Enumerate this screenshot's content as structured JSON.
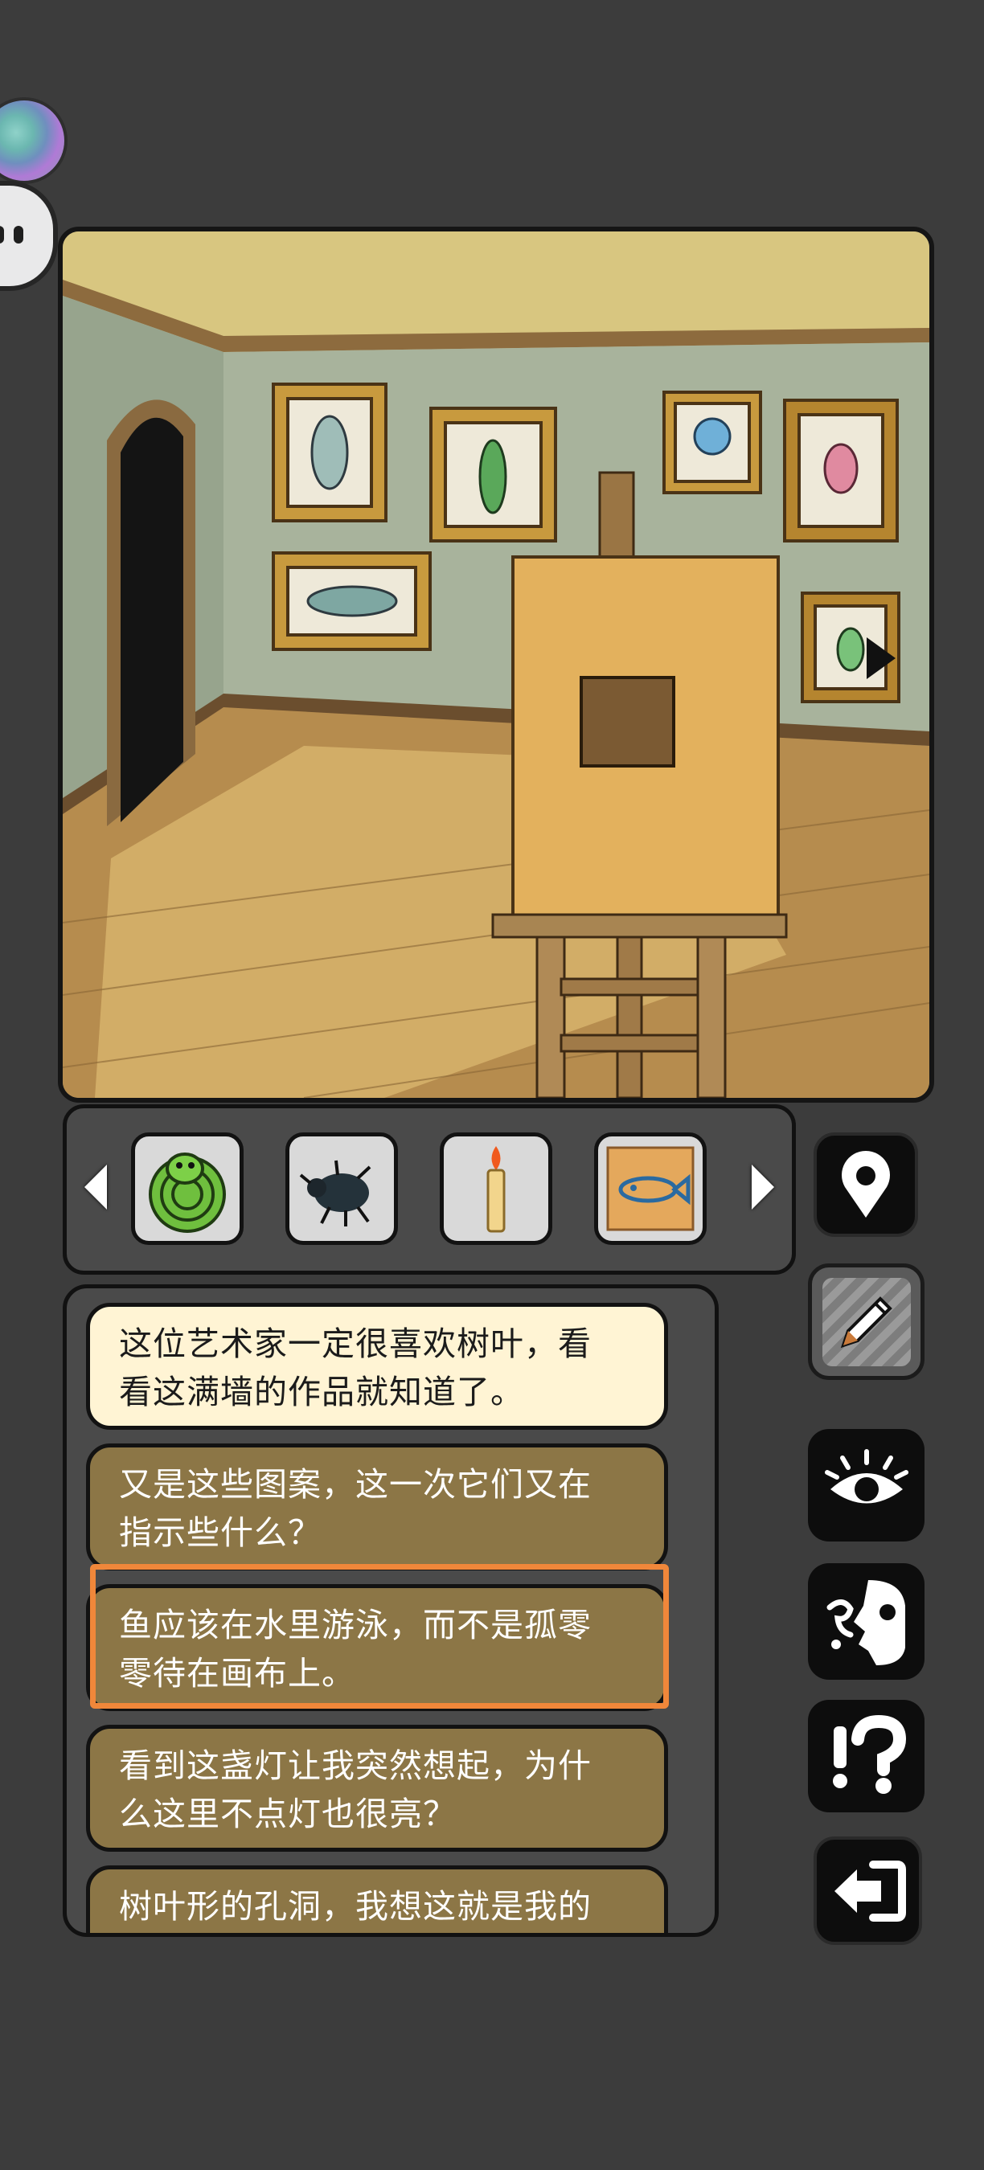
{
  "scene": {
    "has_next_arrow": true
  },
  "inventory": {
    "items": [
      {
        "name": "coiled green snake",
        "icon": "snake-icon"
      },
      {
        "name": "beetle",
        "icon": "beetle-icon"
      },
      {
        "name": "candle",
        "icon": "candle-icon"
      },
      {
        "name": "fish drawing",
        "icon": "fish-drawing-icon"
      }
    ]
  },
  "side_buttons": [
    {
      "name": "map-pin-button",
      "icon": "map-pin-icon"
    },
    {
      "name": "notes-button",
      "icon": "pencil-icon"
    },
    {
      "name": "look-button",
      "icon": "eye-icon"
    },
    {
      "name": "talk-button",
      "icon": "face-talk-icon"
    },
    {
      "name": "hint-button",
      "icon": "exclaim-question-icon"
    },
    {
      "name": "exit-button",
      "icon": "exit-icon"
    }
  ],
  "dialogue": [
    {
      "text": "这位艺术家一定很喜欢树叶，看看这满墙的作品就知道了。",
      "line1": "这位艺术家一定很喜欢树叶，看",
      "line2": "看这满墙的作品就知道了。",
      "selected": false,
      "style": "light"
    },
    {
      "text": "又是这些图案，这一次它们又在指示些什么？",
      "line1": "又是这些图案，这一次它们又在",
      "line2": "指示些什么？",
      "selected": false,
      "style": "brown"
    },
    {
      "text": "鱼应该在水里游泳，而不是孤零零待在画布上。",
      "line1": "鱼应该在水里游泳，而不是孤零",
      "line2": "零待在画布上。",
      "selected": true,
      "style": "brown"
    },
    {
      "text": "看到这盏灯让我突然想起，为什么这里不点灯也很亮？",
      "line1": "看到这盏灯让我突然想起，为什",
      "line2": "么这里不点灯也很亮？",
      "selected": false,
      "style": "brown"
    },
    {
      "text": "树叶形的孔洞，我想这就是我的",
      "line1": "树叶形的孔洞，我想这就是我的",
      "line2": "",
      "selected": false,
      "style": "brown"
    }
  ],
  "colors": {
    "background": "#3c3c3c",
    "panel": "#4a4a4a",
    "dialog_light": "#fff4d4",
    "dialog_brown": "#8c7646",
    "highlight": "#f0873a"
  }
}
